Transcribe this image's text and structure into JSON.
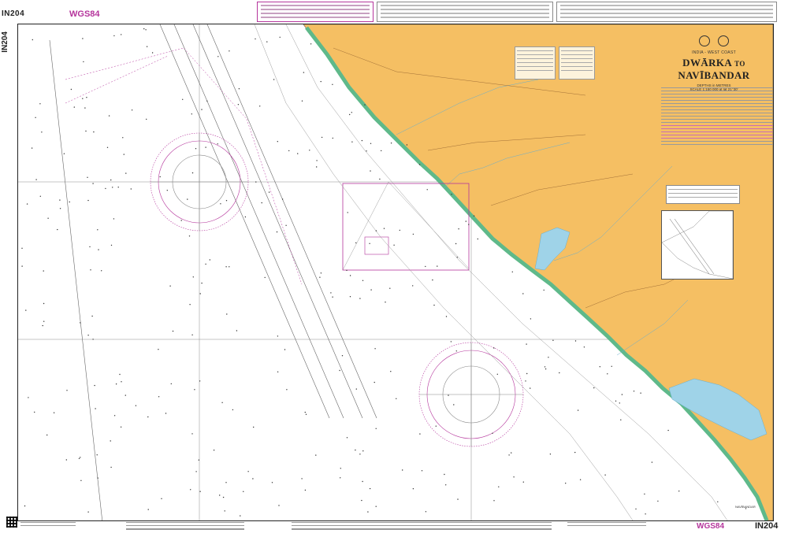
{
  "chart": {
    "number": "IN204",
    "datum": "WGS84",
    "region": "INDIA - WEST COAST",
    "title_part1": "DWĀRKA",
    "title_connector": "TO",
    "title_part2": "NAVĪBANDAR",
    "depths_note": "DEPTHS in METRES",
    "scale_note": "SCALE 1:150 000 at lat 21°30'"
  },
  "colors": {
    "land": "#f5bf63",
    "shallow_water": "#9fd3e8",
    "intertidal": "#5fb98a",
    "magenta": "#b5359c",
    "sea": "#ffffff",
    "grid": "#8a8a8a"
  },
  "map": {
    "features": [
      "compass-rose-north",
      "compass-rose-south",
      "traffic-separation-lanes",
      "restricted-area-box",
      "lake",
      "river-estuary",
      "coastline"
    ],
    "bottom_right_place": "NAVĪBANDAR"
  }
}
